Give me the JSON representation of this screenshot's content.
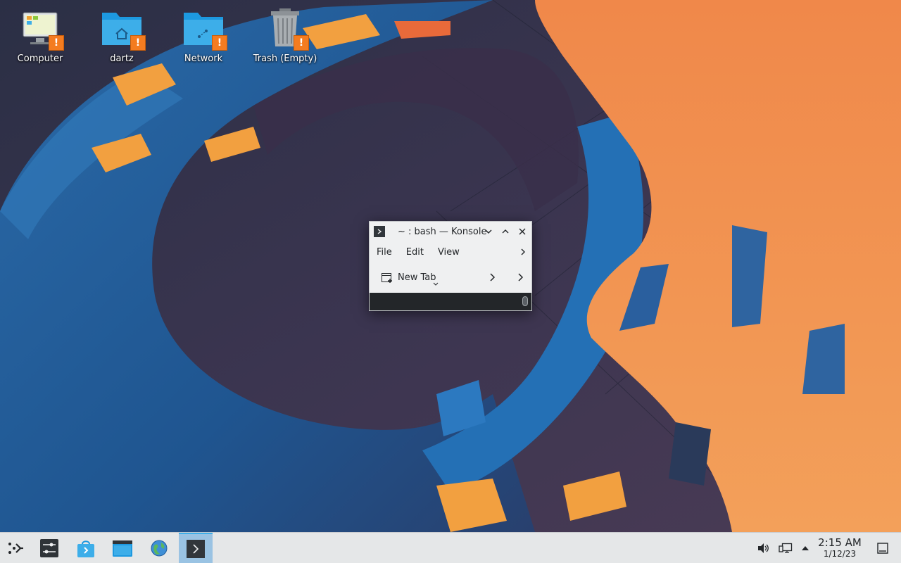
{
  "desktop": {
    "icons": [
      {
        "label": "Computer",
        "icon": "computer-icon"
      },
      {
        "label": "dartz",
        "icon": "home-folder-icon"
      },
      {
        "label": "Network",
        "icon": "network-folder-icon"
      },
      {
        "label": "Trash (Empty)",
        "icon": "trash-icon"
      }
    ],
    "badge": "!"
  },
  "konsole": {
    "title": "~ : bash — Konsole",
    "menus": [
      "File",
      "Edit",
      "View"
    ],
    "toolbar": {
      "new_tab_label": "New Tab"
    }
  },
  "taskbar": {
    "launchers": [
      "application-launcher-icon",
      "system-settings-icon",
      "discover-store-icon",
      "file-manager-icon",
      "web-browser-icon",
      "konsole-icon"
    ],
    "tray": [
      "volume-icon",
      "network-icon",
      "expand-tray-icon",
      "show-desktop-icon"
    ],
    "clock": {
      "time": "2:15 AM",
      "date": "1/12/23"
    }
  },
  "colors": {
    "accent": "#3daee9",
    "warning_badge": "#f47c20",
    "taskbar_bg": "#e5e7e8",
    "window_bg": "#eff0f1",
    "terminal_bg": "#232629"
  }
}
